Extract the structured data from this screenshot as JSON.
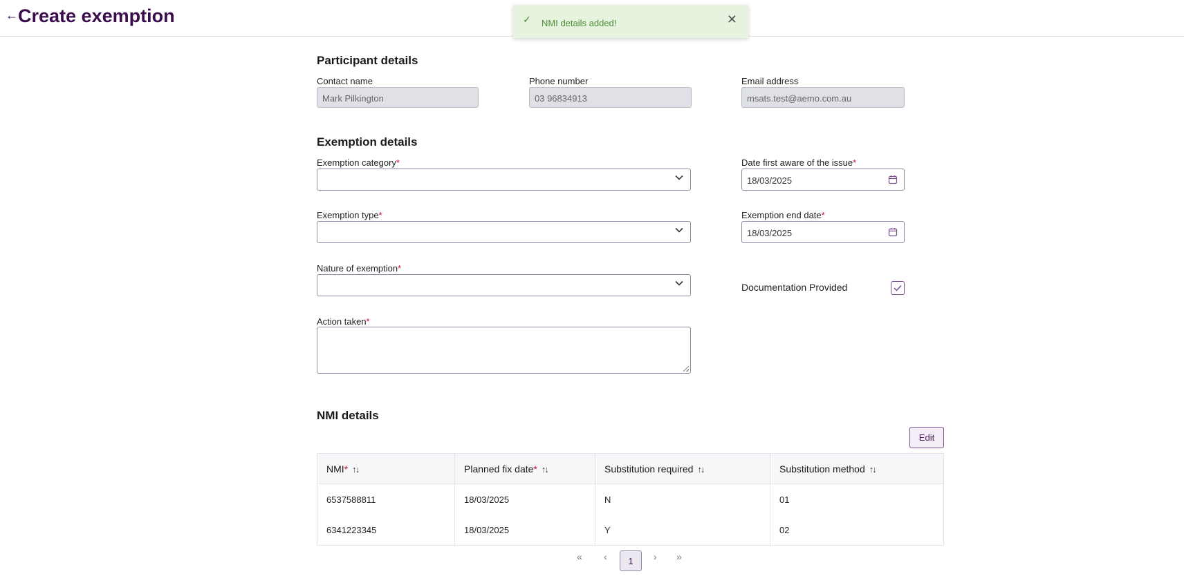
{
  "header": {
    "back_icon": "arrow-left-icon",
    "title": "Create exemption"
  },
  "toast": {
    "message": "NMI details added!",
    "icon": "check-icon"
  },
  "participant": {
    "heading": "Participant details",
    "contact_label": "Contact name",
    "contact_value": "Mark Pilkington",
    "phone_label": "Phone number",
    "phone_value": "03 96834913",
    "email_label": "Email address",
    "email_value": "msats.test@aemo.com.au"
  },
  "exemption": {
    "heading": "Exemption details",
    "category_label": "Exemption category",
    "type_label": "Exemption type",
    "nature_label": "Nature of exemption",
    "action_label": "Action taken",
    "date_aware_label": "Date first aware of the issue",
    "date_aware_value": "18/03/2025",
    "end_date_label": "Exemption end date",
    "end_date_value": "18/03/2025",
    "doc_label": "Documentation Provided",
    "doc_checked": true,
    "required_mark": "*"
  },
  "nmi": {
    "heading": "NMI details",
    "edit_label": "Edit",
    "columns": [
      "NMI",
      "Planned fix date",
      "Substitution required",
      "Substitution method"
    ],
    "rows": [
      [
        "6537588811",
        "18/03/2025",
        "N",
        "01"
      ],
      [
        "6341223345",
        "18/03/2025",
        "Y",
        "02"
      ]
    ]
  },
  "pagination": {
    "first": "«",
    "prev": "‹",
    "current": "1",
    "next": "›",
    "last": "»"
  },
  "colors": {
    "brand": "#3b0d4f",
    "success_bg": "#e6f4df",
    "success_text": "#4c8a34",
    "required": "#c8102e"
  }
}
